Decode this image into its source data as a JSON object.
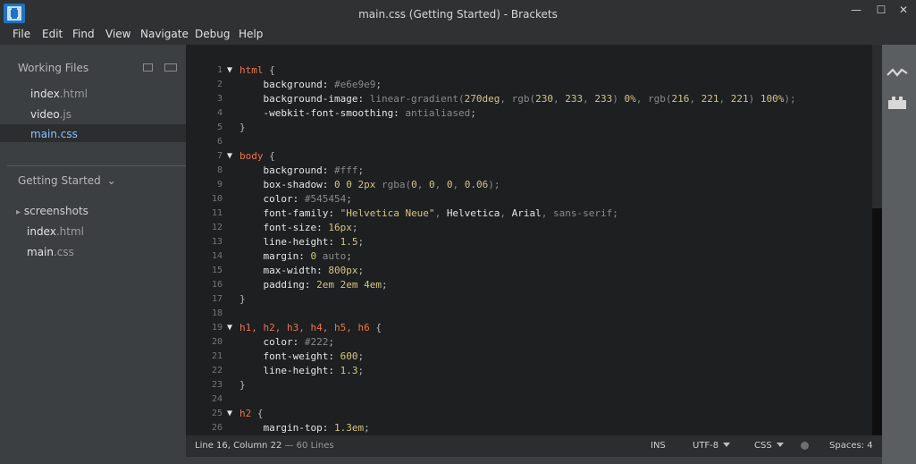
{
  "window": {
    "title": "main.css (Getting Started) - Brackets",
    "minimize": "—",
    "maximize": "☐",
    "close": "✕"
  },
  "menu": [
    "File",
    "Edit",
    "Find",
    "View",
    "Navigate",
    "Debug",
    "Help"
  ],
  "sidebar": {
    "working_files_label": "Working Files",
    "working_files": [
      {
        "name": "index",
        "ext": ".html"
      },
      {
        "name": "video",
        "ext": ".js"
      },
      {
        "name": "main",
        "ext": ".css"
      }
    ],
    "project_label": "Getting Started",
    "project_caret": "⌄",
    "folder": {
      "arrow": "▸",
      "name": "screenshots"
    },
    "project_files": [
      {
        "name": "index",
        "ext": ".html"
      },
      {
        "name": "main",
        "ext": ".css"
      }
    ]
  },
  "editor": {
    "lines": [
      {
        "n": "1",
        "fold": "▼",
        "parts": [
          [
            "sel",
            "html"
          ],
          [
            "kw",
            " {"
          ]
        ]
      },
      {
        "n": "2",
        "parts": [
          [
            "prop",
            "    background: "
          ],
          [
            "val",
            "#e6e9e9"
          ],
          [
            "kw",
            ";"
          ]
        ]
      },
      {
        "n": "3",
        "parts": [
          [
            "prop",
            "    background-image: "
          ],
          [
            "val",
            "linear-gradient("
          ],
          [
            "num",
            "270deg"
          ],
          [
            "val",
            ", rgb("
          ],
          [
            "num",
            "230"
          ],
          [
            "val",
            ", "
          ],
          [
            "num",
            "233"
          ],
          [
            "val",
            ", "
          ],
          [
            "num",
            "233"
          ],
          [
            "val",
            ") "
          ],
          [
            "num",
            "0%"
          ],
          [
            "val",
            ", rgb("
          ],
          [
            "num",
            "216"
          ],
          [
            "val",
            ", "
          ],
          [
            "num",
            "221"
          ],
          [
            "val",
            ", "
          ],
          [
            "num",
            "221"
          ],
          [
            "val",
            ") "
          ],
          [
            "num",
            "100%"
          ],
          [
            "val",
            ");"
          ]
        ]
      },
      {
        "n": "4",
        "parts": [
          [
            "prop",
            "    -webkit-font-smoothing: "
          ],
          [
            "val",
            "antialiased"
          ],
          [
            "kw",
            ";"
          ]
        ]
      },
      {
        "n": "5",
        "parts": [
          [
            "kw",
            "}"
          ]
        ]
      },
      {
        "n": "6",
        "parts": []
      },
      {
        "n": "7",
        "fold": "▼",
        "parts": [
          [
            "sel",
            "body"
          ],
          [
            "kw",
            " {"
          ]
        ]
      },
      {
        "n": "8",
        "parts": [
          [
            "prop",
            "    background: "
          ],
          [
            "val",
            "#fff"
          ],
          [
            "kw",
            ";"
          ]
        ]
      },
      {
        "n": "9",
        "parts": [
          [
            "prop",
            "    box-shadow: "
          ],
          [
            "num",
            "0 0 2px "
          ],
          [
            "val",
            "rgba("
          ],
          [
            "num",
            "0"
          ],
          [
            "val",
            ", "
          ],
          [
            "num",
            "0"
          ],
          [
            "val",
            ", "
          ],
          [
            "num",
            "0"
          ],
          [
            "val",
            ", "
          ],
          [
            "num",
            "0.06"
          ],
          [
            "val",
            ");"
          ]
        ]
      },
      {
        "n": "10",
        "parts": [
          [
            "prop",
            "    color: "
          ],
          [
            "val",
            "#545454"
          ],
          [
            "kw",
            ";"
          ]
        ]
      },
      {
        "n": "11",
        "parts": [
          [
            "prop",
            "    font-family: "
          ],
          [
            "num",
            "\"Helvetica Neue\""
          ],
          [
            "val",
            ", "
          ],
          [
            "prop",
            "Helvetica"
          ],
          [
            "val",
            ", "
          ],
          [
            "prop",
            "Arial"
          ],
          [
            "val",
            ", sans-serif;"
          ]
        ]
      },
      {
        "n": "12",
        "parts": [
          [
            "prop",
            "    font-size: "
          ],
          [
            "num",
            "16px"
          ],
          [
            "kw",
            ";"
          ]
        ]
      },
      {
        "n": "13",
        "parts": [
          [
            "prop",
            "    line-height: "
          ],
          [
            "num",
            "1.5"
          ],
          [
            "kw",
            ";"
          ]
        ]
      },
      {
        "n": "14",
        "parts": [
          [
            "prop",
            "    margin: "
          ],
          [
            "num",
            "0"
          ],
          [
            "val",
            " auto"
          ],
          [
            "kw",
            ";"
          ]
        ]
      },
      {
        "n": "15",
        "parts": [
          [
            "prop",
            "    max-width: "
          ],
          [
            "num",
            "800px"
          ],
          [
            "kw",
            ";"
          ]
        ]
      },
      {
        "n": "16",
        "parts": [
          [
            "prop",
            "    padding: "
          ],
          [
            "num",
            "2em 2em 4em"
          ],
          [
            "kw",
            ";"
          ]
        ]
      },
      {
        "n": "17",
        "parts": [
          [
            "kw",
            "}"
          ]
        ]
      },
      {
        "n": "18",
        "parts": []
      },
      {
        "n": "19",
        "fold": "▼",
        "parts": [
          [
            "sel",
            "h1, h2, h3, h4, h5, h6"
          ],
          [
            "kw",
            " {"
          ]
        ]
      },
      {
        "n": "20",
        "parts": [
          [
            "prop",
            "    color: "
          ],
          [
            "val",
            "#222"
          ],
          [
            "kw",
            ";"
          ]
        ]
      },
      {
        "n": "21",
        "parts": [
          [
            "prop",
            "    font-weight: "
          ],
          [
            "num",
            "600"
          ],
          [
            "kw",
            ";"
          ]
        ]
      },
      {
        "n": "22",
        "parts": [
          [
            "prop",
            "    line-height: "
          ],
          [
            "num",
            "1.3"
          ],
          [
            "kw",
            ";"
          ]
        ]
      },
      {
        "n": "23",
        "parts": [
          [
            "kw",
            "}"
          ]
        ]
      },
      {
        "n": "24",
        "parts": []
      },
      {
        "n": "25",
        "fold": "▼",
        "parts": [
          [
            "sel",
            "h2"
          ],
          [
            "kw",
            " {"
          ]
        ]
      },
      {
        "n": "26",
        "parts": [
          [
            "prop",
            "    margin-top: "
          ],
          [
            "num",
            "1.3em"
          ],
          [
            "kw",
            ";"
          ]
        ]
      }
    ]
  },
  "status": {
    "position": "Line 16, Column 22",
    "lines": "— 60 Lines",
    "mode": "INS",
    "encoding": "UTF-8",
    "language": "CSS",
    "spaces": "Spaces: 4"
  },
  "colors": {
    "accent": "#8fc1ff",
    "selector": "#e8764d",
    "number": "#d3c580"
  },
  "icons": {
    "live_preview": "live-preview-icon",
    "extension_manager": "extension-manager-icon"
  }
}
